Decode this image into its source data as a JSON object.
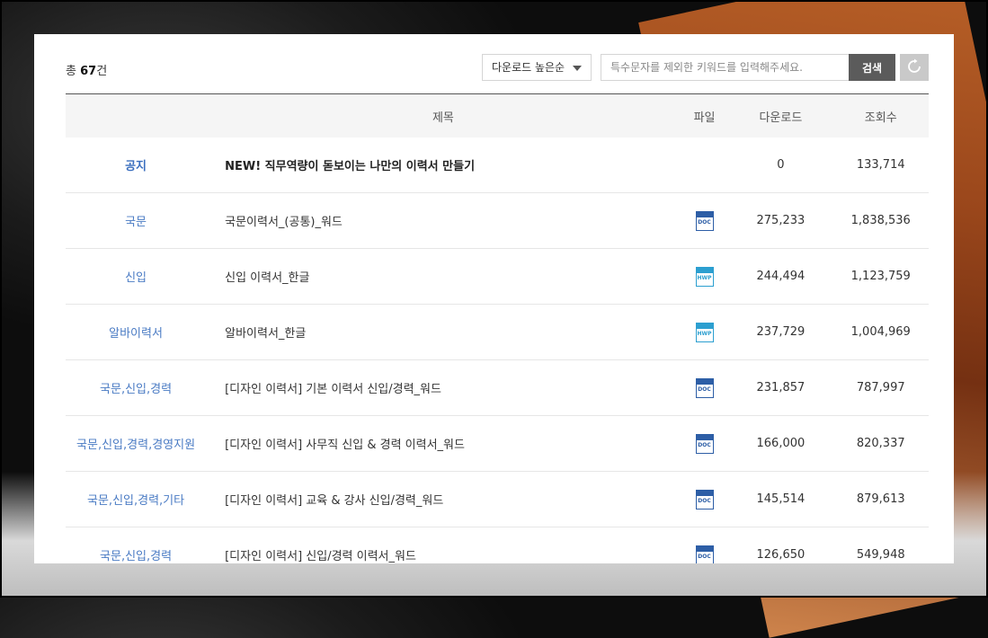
{
  "summary": {
    "prefix": "총",
    "count": "67",
    "suffix": "건"
  },
  "sort": {
    "selected": "다운로드 높은순"
  },
  "search": {
    "placeholder": "특수문자를 제외한 키워드를 입력해주세요.",
    "button_label": "검색"
  },
  "icons": {
    "reset": "reset-icon",
    "doc": "doc-file-icon",
    "hwp": "hwp-file-icon"
  },
  "colors": {
    "category": "#4a7bc4",
    "doc": "#2d5ea6",
    "hwp": "#2c9fd0",
    "search_button": "#5b5b5b"
  },
  "table": {
    "headers": [
      "제목",
      "파일",
      "다운로드",
      "조회수"
    ],
    "rows": [
      {
        "category": "공지",
        "title": "NEW! 직무역량이 돋보이는 나만의 이력서 만들기",
        "file": "",
        "downloads": "0",
        "views": "133,714",
        "notice": true
      },
      {
        "category": "국문",
        "title": "국문이력서_(공통)_워드",
        "file": "DOC",
        "downloads": "275,233",
        "views": "1,838,536"
      },
      {
        "category": "신입",
        "title": "신입 이력서_한글",
        "file": "HWP",
        "downloads": "244,494",
        "views": "1,123,759"
      },
      {
        "category": "알바이력서",
        "title": "알바이력서_한글",
        "file": "HWP",
        "downloads": "237,729",
        "views": "1,004,969"
      },
      {
        "category": "국문,신입,경력",
        "title": "[디자인 이력서] 기본 이력서 신입/경력_워드",
        "file": "DOC",
        "downloads": "231,857",
        "views": "787,997"
      },
      {
        "category": "국문,신입,경력,경영지원",
        "title": "[디자인 이력서] 사무직 신입 & 경력 이력서_워드",
        "file": "DOC",
        "downloads": "166,000",
        "views": "820,337"
      },
      {
        "category": "국문,신입,경력,기타",
        "title": "[디자인 이력서] 교육 & 강사 신입/경력_워드",
        "file": "DOC",
        "downloads": "145,514",
        "views": "879,613"
      },
      {
        "category": "국문,신입,경력",
        "title": "[디자인 이력서] 신입/경력 이력서_워드",
        "file": "DOC",
        "downloads": "126,650",
        "views": "549,948"
      }
    ]
  }
}
